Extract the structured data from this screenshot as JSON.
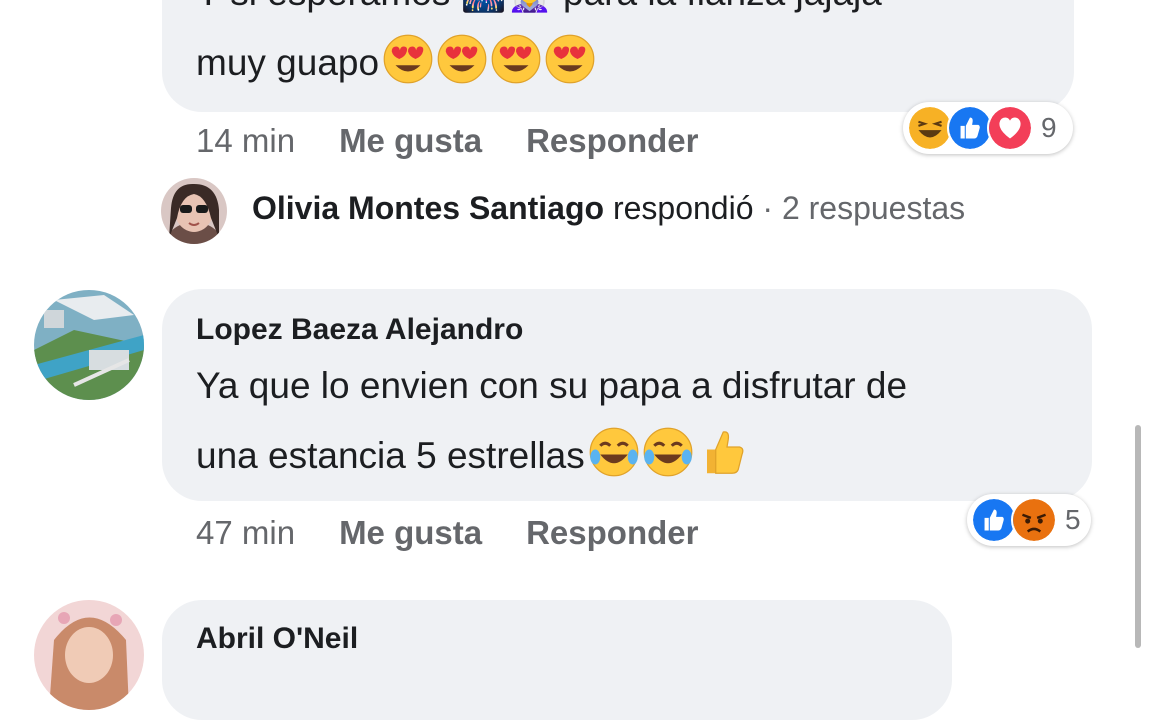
{
  "comment_top": {
    "partial_text": "Y si esperamos 🎆🧝‍♀️ para la fianza jajaja",
    "text_line": "muy guapo",
    "emojis": [
      "heart-eyes",
      "heart-eyes",
      "heart-eyes",
      "heart-eyes"
    ],
    "time": "14 min",
    "like_label": "Me gusta",
    "reply_label": "Responder",
    "reactions": {
      "icons": [
        "laugh-reaction-icon",
        "like-reaction-icon",
        "love-reaction-icon"
      ],
      "count": "9"
    }
  },
  "reply_summary": {
    "name": "Olivia Montes Santiago",
    "action": "respondió",
    "separator": "·",
    "count_text": "2 respuestas"
  },
  "comment_main": {
    "author": "Lopez Baeza Alejandro",
    "line1": "Ya que lo envien con su papa a disfrutar de",
    "line2": "una estancia 5 estrellas",
    "time": "47 min",
    "like_label": "Me gusta",
    "reply_label": "Responder",
    "reactions": {
      "icons": [
        "like-reaction-icon",
        "angry-reaction-icon"
      ],
      "count": "5"
    }
  },
  "comment_bottom": {
    "author": "Abril O'Neil"
  },
  "colors": {
    "bubble": "#eff1f4",
    "muted": "#65676b",
    "like_blue": "#1877f2",
    "love_red": "#f33e58",
    "emoji_yellow": "#ffc83d"
  }
}
